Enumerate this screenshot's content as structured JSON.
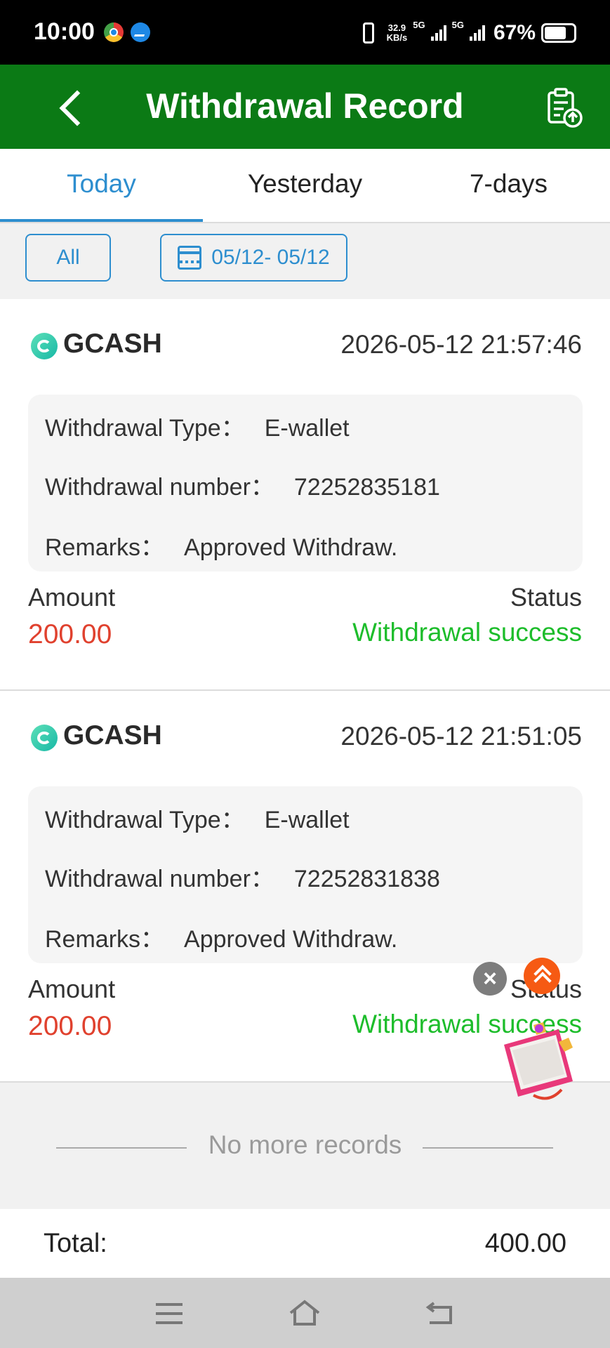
{
  "status_bar": {
    "time": "10:00",
    "speed_value": "32.9",
    "speed_unit": "KB/s",
    "net1": "5G",
    "net2": "5G",
    "battery": "67%"
  },
  "header": {
    "title": "Withdrawal Record"
  },
  "tabs": [
    {
      "label": "Today",
      "active": true
    },
    {
      "label": "Yesterday",
      "active": false
    },
    {
      "label": "7-days",
      "active": false
    }
  ],
  "filters": {
    "all_label": "All",
    "date_range": "05/12- 05/12"
  },
  "records": [
    {
      "provider": "GCASH",
      "datetime": "2026-05-12 21:57:46",
      "type_label": "Withdrawal Type：",
      "type_value": "E-wallet",
      "number_label": "Withdrawal number：",
      "number_value": "72252835181",
      "remarks_label": "Remarks：",
      "remarks_value": "Approved Withdraw.",
      "amount_label": "Amount",
      "amount": "200.00",
      "status_label": "Status",
      "status": "Withdrawal success"
    },
    {
      "provider": "GCASH",
      "datetime": "2026-05-12 21:51:05",
      "type_label": "Withdrawal Type：",
      "type_value": "E-wallet",
      "number_label": "Withdrawal number：",
      "number_value": "72252831838",
      "remarks_label": "Remarks：",
      "remarks_value": "Approved Withdraw.",
      "amount_label": "Amount",
      "amount": "200.00",
      "status_label": "Status",
      "status": "Withdrawal success"
    }
  ],
  "footer": {
    "no_more": "No more records",
    "total_label": "Total:",
    "total_value": "400.00"
  },
  "colors": {
    "header_bg": "#0b7a15",
    "accent": "#2d8ecf",
    "amount": "#e0412e",
    "success": "#1dbd2b"
  }
}
